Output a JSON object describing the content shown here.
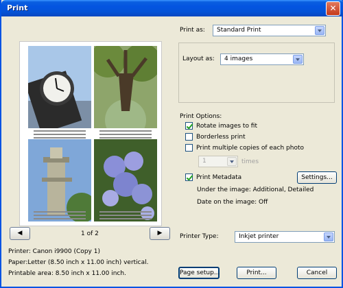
{
  "window": {
    "title": "Print",
    "close_glyph": "✕"
  },
  "preview": {
    "page_label": "1 of 2",
    "prev_glyph": "◀",
    "next_glyph": "▶"
  },
  "printer_info": {
    "printer": "Printer: Canon i9900 (Copy 1)",
    "paper": "Paper:Letter (8.50 inch x 11.00 inch) vertical.",
    "printable": "Printable area: 8.50 inch x 11.00 inch."
  },
  "print_as": {
    "label": "Print as:",
    "value": "Standard Print"
  },
  "layout_as": {
    "label": "Layout as:",
    "value": "4 images"
  },
  "print_options": {
    "label": "Print Options:",
    "rotate": {
      "label": "Rotate images to fit",
      "checked": true
    },
    "borderless": {
      "label": "Borderless print",
      "checked": false
    },
    "multiple": {
      "label": "Print multiple copies of each photo",
      "checked": false
    },
    "copies_value": "1",
    "times_label": "times",
    "metadata": {
      "label": "Print Metadata",
      "checked": true
    },
    "settings_button": "Settings...",
    "under_image": "Under the image: Additional, Detailed",
    "date_on_image": "Date on the image: Off"
  },
  "printer_type": {
    "label": "Printer Type:",
    "value": "Inkjet printer"
  },
  "buttons": {
    "page_setup": "Page setup...",
    "print": "Print...",
    "cancel": "Cancel"
  }
}
